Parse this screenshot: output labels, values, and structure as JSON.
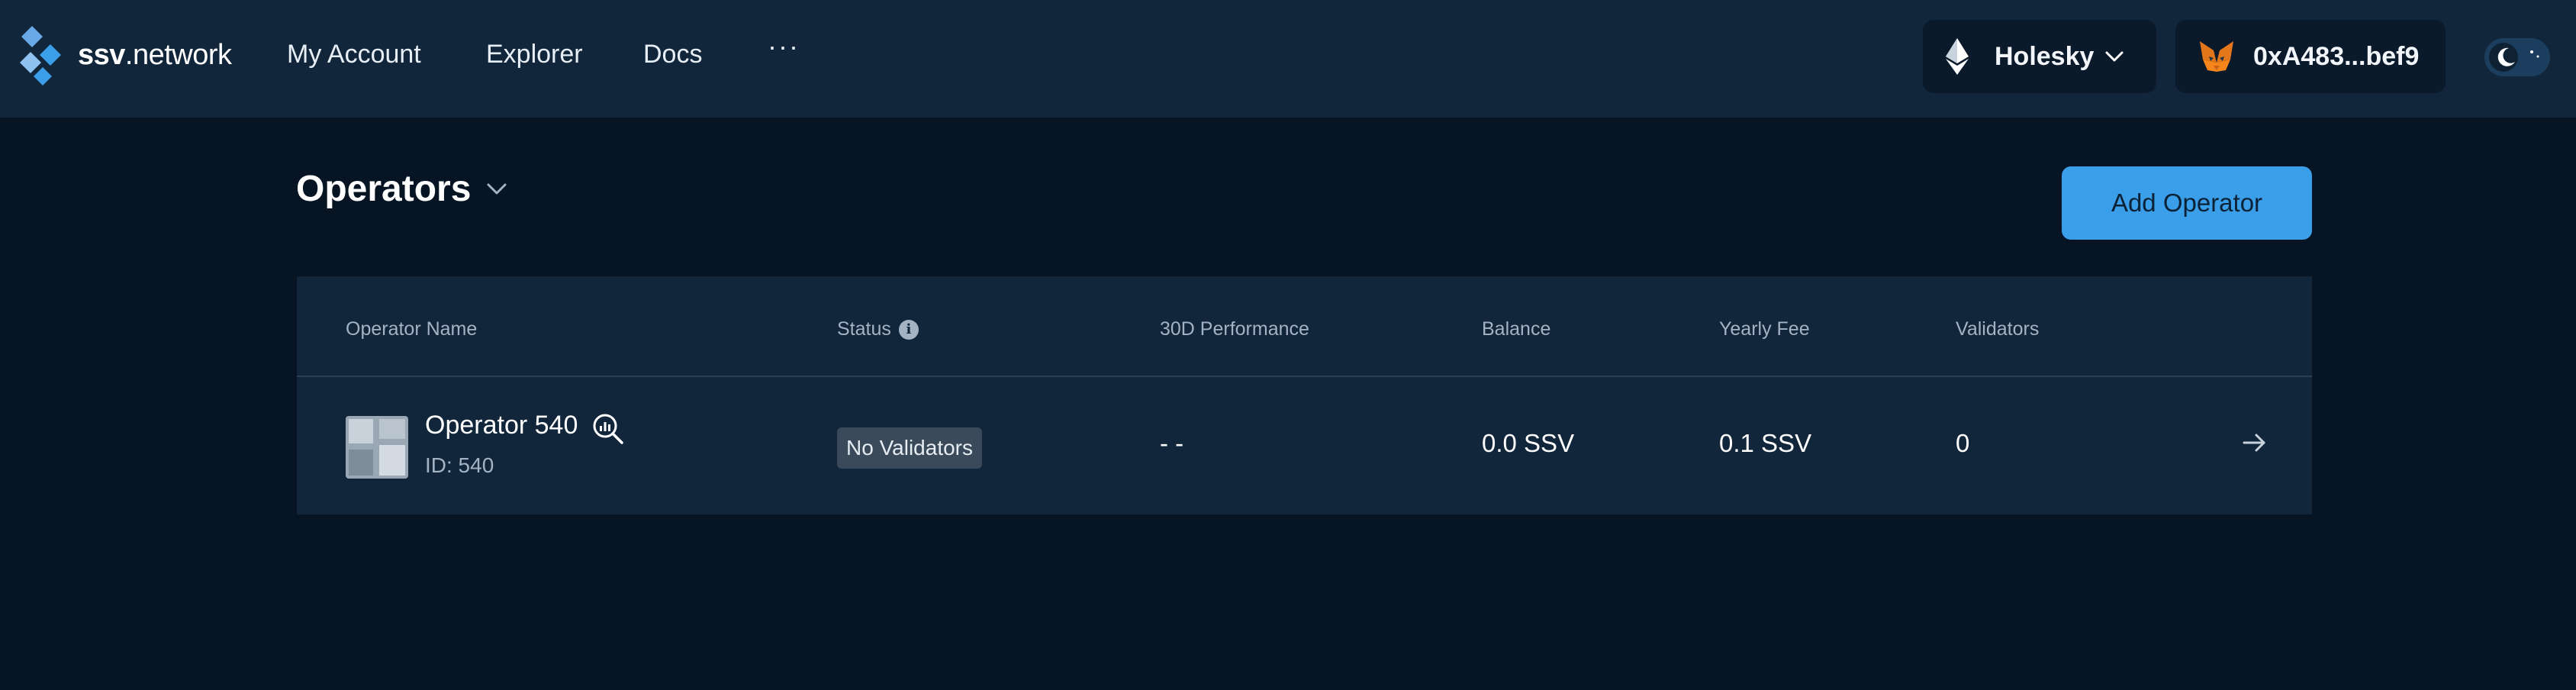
{
  "brand": {
    "name_bold": "ssv",
    "name_rest": ".network"
  },
  "nav": {
    "links": [
      "My Account",
      "Explorer",
      "Docs"
    ],
    "more": "···"
  },
  "network": {
    "label": "Holesky",
    "icon": "ethereum-icon"
  },
  "wallet": {
    "address": "0xA483...bef9",
    "icon": "metamask-fox-icon"
  },
  "theme": {
    "mode": "dark",
    "icon": "moon-icon"
  },
  "page": {
    "title": "Operators",
    "add_button": "Add Operator"
  },
  "table": {
    "columns": [
      "Operator Name",
      "Status",
      "30D Performance",
      "Balance",
      "Yearly Fee",
      "Validators"
    ],
    "status_info_icon": "i",
    "rows": [
      {
        "name": "Operator 540",
        "id": "ID: 540",
        "status": "No Validators",
        "performance": "- -",
        "balance": "0.0 SSV",
        "yearly_fee": "0.1 SSV",
        "validators": "0"
      }
    ]
  },
  "colors": {
    "background": "#061423",
    "surface": "#11263a",
    "accent": "#3b9ee8",
    "muted_text": "#a3b3c4"
  }
}
